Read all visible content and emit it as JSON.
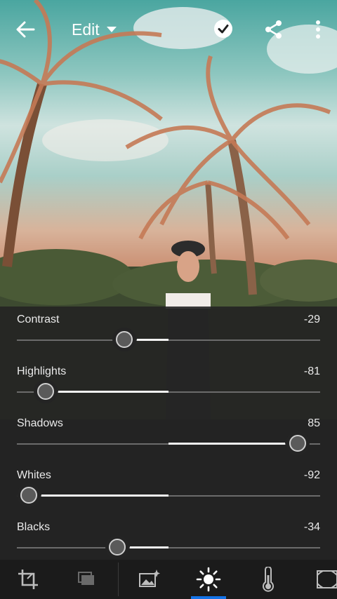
{
  "header": {
    "title": "Edit",
    "icons": [
      "back-arrow-icon",
      "chevron-down-icon",
      "check-circle-icon",
      "share-icon",
      "more-vertical-icon"
    ]
  },
  "adjustments": [
    {
      "label": "Contrast",
      "value": "-29",
      "fraction": 0.355
    },
    {
      "label": "Highlights",
      "value": "-81",
      "fraction": 0.095
    },
    {
      "label": "Shadows",
      "value": "85",
      "fraction": 0.925
    },
    {
      "label": "Whites",
      "value": "-92",
      "fraction": 0.04
    },
    {
      "label": "Blacks",
      "value": "-34",
      "fraction": 0.33
    }
  ],
  "toolbar": {
    "tools": [
      "crop-icon",
      "presets-icon",
      "auto-enhance-icon",
      "light-icon",
      "color-temperature-icon",
      "vignette-icon"
    ],
    "active": "light-icon",
    "accent": "#1473e6"
  }
}
